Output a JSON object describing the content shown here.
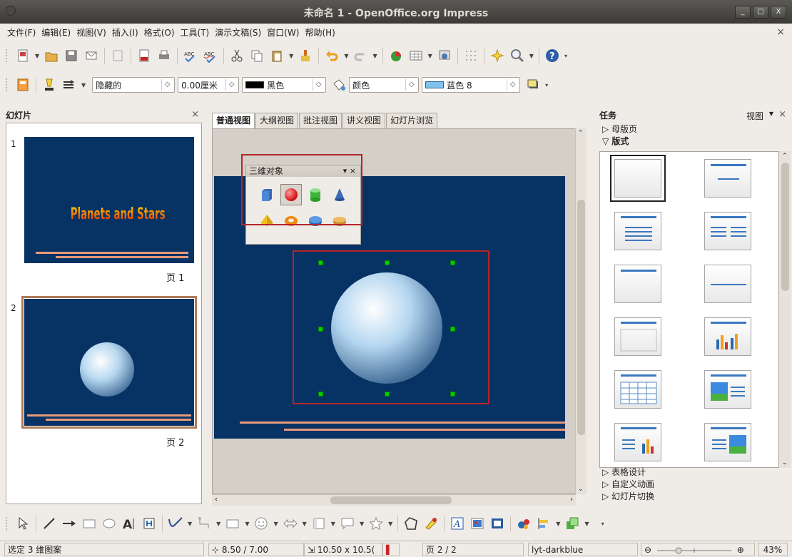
{
  "window": {
    "title": "未命名 1 - OpenOffice.org Impress",
    "buttons": [
      "_",
      "□",
      "X"
    ]
  },
  "menu": [
    "文件(F)",
    "编辑(E)",
    "视图(V)",
    "插入(I)",
    "格式(O)",
    "工具(T)",
    "演示文稿(S)",
    "窗口(W)",
    "帮助(H)"
  ],
  "menu_close": "×",
  "line_toolbar": {
    "line_style": "隐藏的",
    "line_width": "0.00厘米",
    "line_color": "黑色",
    "area_style": "颜色",
    "area_color": "蓝色 8"
  },
  "slides_panel": {
    "title": "幻灯片",
    "close": "×",
    "slides": [
      {
        "number": "1",
        "label": "页 1",
        "text": "Planets and Stars"
      },
      {
        "number": "2",
        "label": "页 2"
      }
    ]
  },
  "view_tabs": [
    "普通视图",
    "大纲视图",
    "批注视图",
    "讲义视图",
    "幻灯片浏览"
  ],
  "float_3d": {
    "title": "三维对象",
    "close": "×",
    "shapes": [
      "cube-icon",
      "sphere-icon",
      "cylinder-icon",
      "cone-icon",
      "pyramid-icon",
      "torus-icon",
      "shell-icon",
      "half-sphere-icon"
    ]
  },
  "tasks_panel": {
    "title": "任务",
    "view_label": "视图",
    "close": "×",
    "sections_top": [
      "母版页",
      "版式"
    ],
    "sections_bottom": [
      "表格设计",
      "自定义动画",
      "幻灯片切换"
    ]
  },
  "status": {
    "selection": "选定 3 维图案",
    "position": "8.50 / 7.00",
    "size": "10.50 x 10.5(",
    "page": "页 2 / 2",
    "master": "lyt-darkblue",
    "zoom": "43%"
  },
  "colors": {
    "slide_bg": "#063264",
    "accent_red": "#b2262a",
    "stripe": "#e79a7a"
  }
}
